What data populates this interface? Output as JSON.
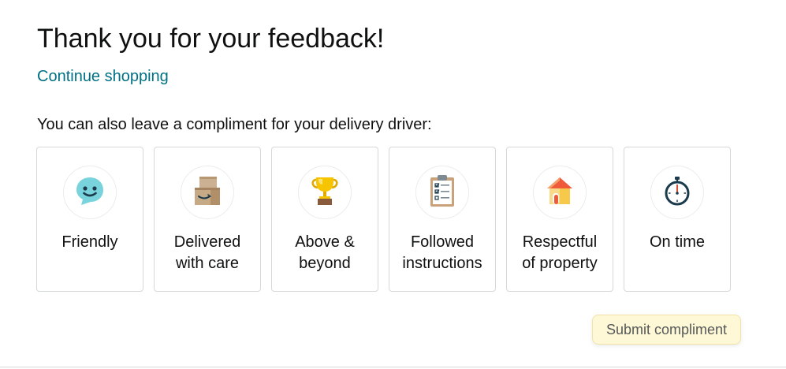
{
  "header": {
    "title": "Thank you for your feedback!",
    "continue_link": "Continue shopping"
  },
  "compliments": {
    "prompt": "You can also leave a compliment for your delivery driver:",
    "options": [
      {
        "label": "Friendly",
        "icon": "smiley-face-icon"
      },
      {
        "label": "Delivered\nwith care",
        "icon": "boxes-icon"
      },
      {
        "label": "Above &\nbeyond",
        "icon": "trophy-icon"
      },
      {
        "label": "Followed\ninstructions",
        "icon": "clipboard-checklist-icon"
      },
      {
        "label": "Respectful\nof property",
        "icon": "house-icon"
      },
      {
        "label": "On time",
        "icon": "stopwatch-icon"
      }
    ],
    "submit_label": "Submit compliment"
  },
  "colors": {
    "link": "#007185",
    "submit_bg": "#fff8d6",
    "card_border": "#d5d9d9"
  }
}
